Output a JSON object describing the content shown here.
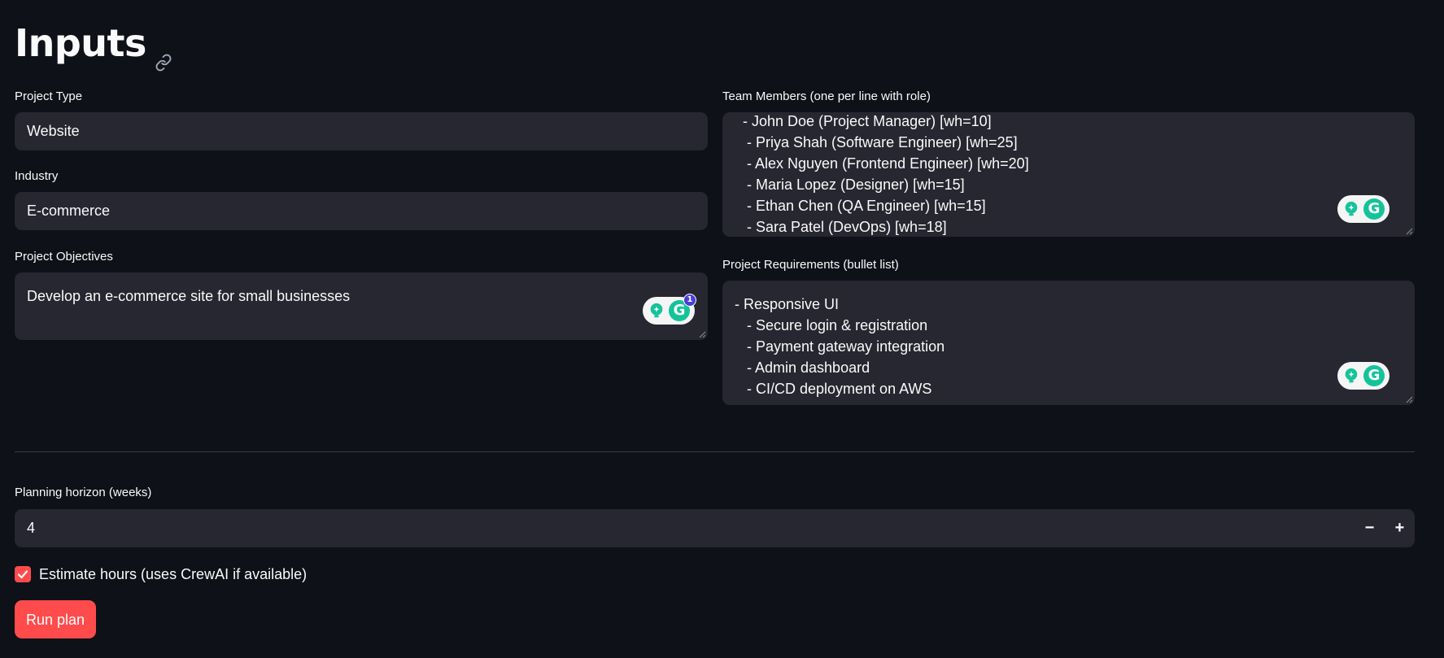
{
  "header": {
    "title": "Inputs",
    "link_icon": "link-icon"
  },
  "project_type": {
    "label": "Project Type",
    "value": "Website"
  },
  "industry": {
    "label": "Industry",
    "value": "E-commerce"
  },
  "objectives": {
    "label": "Project Objectives",
    "value": "Develop an e-commerce site for small businesses",
    "grammarly_badge": "1"
  },
  "team_members": {
    "label": "Team Members (one per line with role)",
    "value": "  - John Doe (Project Manager) [wh=10]\n   - Priya Shah (Software Engineer) [wh=25]\n   - Alex Nguyen (Frontend Engineer) [wh=20]\n   - Maria Lopez (Designer) [wh=15]\n   - Ethan Chen (QA Engineer) [wh=15]\n   - Sara Patel (DevOps) [wh=18]"
  },
  "requirements": {
    "label": "Project Requirements (bullet list)",
    "value": "- Responsive UI\n   - Secure login & registration\n   - Payment gateway integration\n   - Admin dashboard\n   - CI/CD deployment on AWS"
  },
  "planning_horizon": {
    "label": "Planning horizon (weeks)",
    "value": "4",
    "decrement": "−",
    "increment": "+"
  },
  "estimate_hours": {
    "label": "Estimate hours (uses CrewAI if available)",
    "checked": true
  },
  "run_button": {
    "label": "Run plan"
  },
  "colors": {
    "background": "#0e1117",
    "field": "#262730",
    "accent": "#ff4b4b",
    "grammarly": "#15c39a"
  }
}
